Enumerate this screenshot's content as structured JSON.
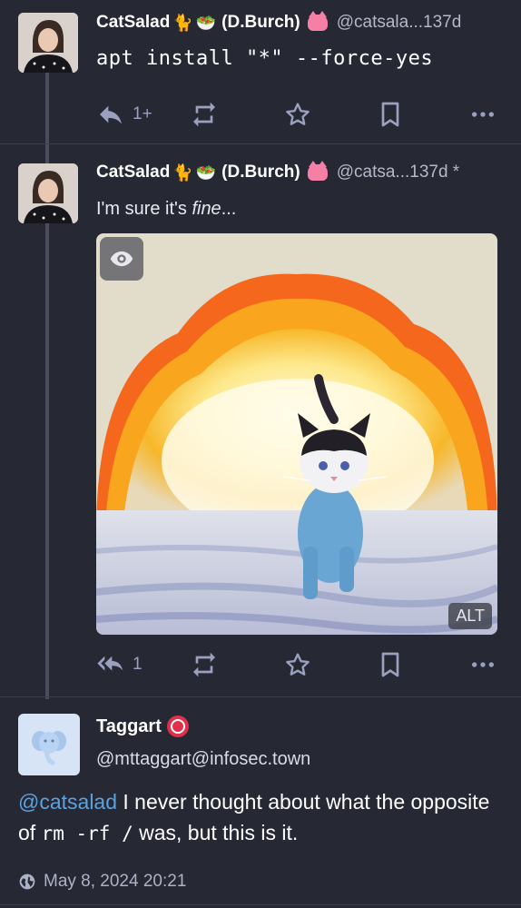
{
  "post1": {
    "display_name": "CatSalad",
    "name_suffix": "(D.Burch)",
    "handle": "@catsala...",
    "time": "137d",
    "body": "apt install \"*\" --force-yes",
    "reply_count": "1+"
  },
  "post2": {
    "display_name": "CatSalad",
    "name_suffix": "(D.Burch)",
    "handle": "@catsa...",
    "time": "137d *",
    "body_prefix": "I'm sure it's ",
    "body_emphasis": "fine",
    "body_suffix": "...",
    "media_alt_badge": "ALT",
    "reply_count": "1"
  },
  "detail": {
    "display_name": "Taggart",
    "handle": "@mttaggart@infosec.town",
    "mention": "@catsalad",
    "body_a": " I never thought about what the opposite of ",
    "body_code": "rm -rf /",
    "body_b": " was, but this is it.",
    "date": "May 8, 2024 20:21"
  },
  "colors": {
    "background": "#262834",
    "accent_link": "#5aa3e0",
    "icon_muted": "#9aa0bd"
  },
  "icons": {
    "reply": "reply-icon",
    "reply_all": "reply-all-icon",
    "boost": "boost-icon",
    "favourite": "star-icon",
    "bookmark": "bookmark-icon",
    "more": "more-icon",
    "visibility": "globe-icon",
    "reveal": "eye-icon"
  }
}
